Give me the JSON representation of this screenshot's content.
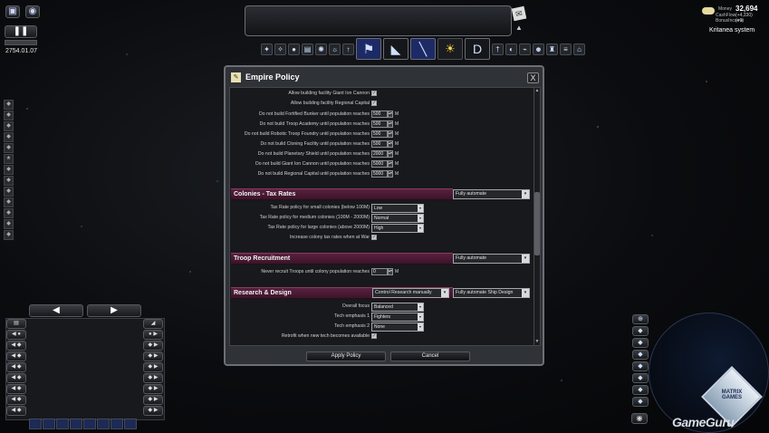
{
  "hud": {
    "date": "2754.01.07",
    "money_label": "Money",
    "cashflow_label": "CashFlow",
    "bonus_label": "BonusIncome",
    "money_value": "32,694",
    "cashflow_value": "(+4,330)",
    "bonus_value": "(+0)",
    "system_name": "Kritanea system",
    "watermark": "GameGuru",
    "logo_text": "MATRIX GAMES"
  },
  "dialog": {
    "title": "Empire Policy",
    "close_label": "X",
    "checkbox_rows": [
      {
        "label": "Allow building facility Giant Ion Cannon",
        "checked": true
      },
      {
        "label": "Allow building facility Regional Capital",
        "checked": true
      }
    ],
    "population_rows": [
      {
        "label": "Do not build Fortified Bunker until population reaches",
        "value": "500",
        "unit": "M"
      },
      {
        "label": "Do not build Troop Academy until population reaches",
        "value": "500",
        "unit": "M"
      },
      {
        "label": "Do not build Robotic Troop Foundry until population reaches",
        "value": "500",
        "unit": "M"
      },
      {
        "label": "Do not build Cloning Facility until population reaches",
        "value": "500",
        "unit": "M"
      },
      {
        "label": "Do not build Planetary Shield until population reaches",
        "value": "2000",
        "unit": "M"
      },
      {
        "label": "Do not build Giant Ion Cannon until population reaches",
        "value": "5000",
        "unit": "M"
      },
      {
        "label": "Do not build Regional Capital until population reaches",
        "value": "5000",
        "unit": "M"
      }
    ],
    "tax_section": {
      "title": "Colonies - Tax Rates",
      "select": "Fully automate",
      "rows": [
        {
          "label": "Tax Rate policy for small colonies (below 100M)",
          "value": "Low"
        },
        {
          "label": "Tax Rate policy for medium colonies (100M - 2000M)",
          "value": "Normal"
        },
        {
          "label": "Tax Rate policy for large colonies (above 2000M)",
          "value": "High"
        }
      ],
      "war_label": "Increase colony tax rates when at War",
      "war_checked": true
    },
    "troop_section": {
      "title": "Troop Recruitment",
      "select": "Fully automate",
      "row_label": "Never recruit Troops until colony population reaches",
      "row_value": "0",
      "row_unit": "M"
    },
    "research_section": {
      "title": "Research & Design",
      "select1": "Control Research manually",
      "select2": "Fully automate Ship Design",
      "rows": [
        {
          "label": "Overall focus",
          "value": "Balanced"
        },
        {
          "label": "Tech emphasis 1",
          "value": "Fighters"
        },
        {
          "label": "Tech emphasis 2",
          "value": "None"
        }
      ],
      "retrofit_label": "Retrofit when new tech becomes available",
      "retrofit_checked": true
    },
    "apply_label": "Apply Policy",
    "cancel_label": "Cancel"
  },
  "icons": {
    "top_left": [
      "camera-icon",
      "eye-icon"
    ],
    "play": "pause-icon",
    "toolbar": [
      "wrench-icon",
      "star-icon",
      "planet-icon",
      "document-icon",
      "gear-icon",
      "sun-icon",
      "rocket-icon",
      "flags-icon",
      "ship-icon",
      "bulb-icon",
      "research-icon",
      "sword-icon",
      "planet2-icon",
      "ship2-icon",
      "crowd-icon",
      "troop-icon",
      "fleet-icon",
      "home-icon"
    ]
  },
  "colors": {
    "section": "#4a1b36",
    "dialog": "#2f3237",
    "accent": "#1d2a66"
  }
}
